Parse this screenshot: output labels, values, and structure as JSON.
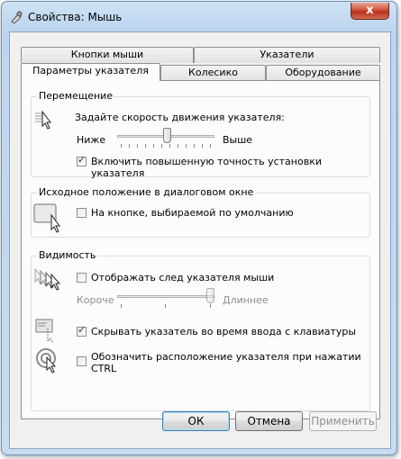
{
  "window": {
    "title": "Свойства: Мышь",
    "close_glyph": "x"
  },
  "tabs_back": [
    "Кнопки мыши",
    "Указатели"
  ],
  "tabs_front": [
    "Параметры указателя",
    "Колесико",
    "Оборудование"
  ],
  "motion": {
    "label": "Перемещение",
    "prompt": "Задайте скорость движения указателя:",
    "slow": "Ниже",
    "fast": "Выше",
    "speed_fraction": 0.52,
    "precision_label": "Включить повышенную точность установки указателя",
    "precision_checked": true
  },
  "snap": {
    "label": "Исходное положение в диалоговом окне",
    "checkbox_label": "На кнопке, выбираемой по умолчанию",
    "checked": false
  },
  "visibility": {
    "label": "Видимость",
    "trails_label": "Отображать след указателя мыши",
    "trails_checked": false,
    "short": "Короче",
    "long": "Длиннее",
    "trails_fraction": 1.0,
    "hide_label": "Скрывать указатель во время ввода с клавиатуры",
    "hide_checked": true,
    "ctrl_label_line1": "Обозначить расположение указателя при нажатии",
    "ctrl_label_line2": "CTRL",
    "ctrl_checked": false
  },
  "buttons": {
    "ok": "ОК",
    "cancel": "Отмена",
    "apply": "Применить"
  },
  "check_glyph": "✓"
}
